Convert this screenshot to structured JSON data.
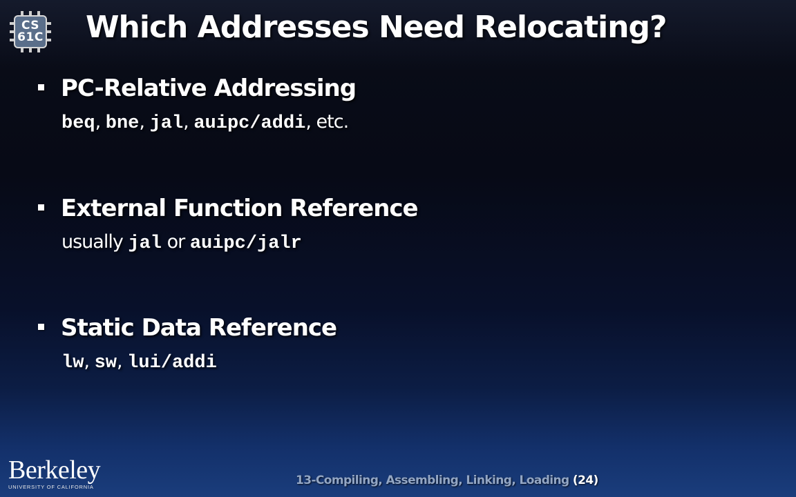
{
  "logo": {
    "line1": "CS",
    "line2": "61C"
  },
  "title": "Which Addresses Need Relocating?",
  "bullets": [
    {
      "heading": "PC-Relative Addressing",
      "detail": [
        {
          "text": "beq",
          "style": "code"
        },
        {
          "text": ", ",
          "style": "plain"
        },
        {
          "text": "bne",
          "style": "code"
        },
        {
          "text": ", ",
          "style": "plain"
        },
        {
          "text": "jal",
          "style": "code"
        },
        {
          "text": ", ",
          "style": "plain"
        },
        {
          "text": "auipc/addi",
          "style": "code"
        },
        {
          "text": ", etc.",
          "style": "plain"
        }
      ]
    },
    {
      "heading": "External Function Reference",
      "detail": [
        {
          "text": "usually ",
          "style": "plain"
        },
        {
          "text": "jal",
          "style": "code"
        },
        {
          "text": " or ",
          "style": "plain"
        },
        {
          "text": "auipc/jalr",
          "style": "code"
        }
      ]
    },
    {
      "heading": "Static Data Reference",
      "detail": [
        {
          "text": "lw",
          "style": "code"
        },
        {
          "text": ", ",
          "style": "plain"
        },
        {
          "text": "sw",
          "style": "code"
        },
        {
          "text": ", ",
          "style": "plain"
        },
        {
          "text": "lui/addi",
          "style": "code"
        }
      ]
    }
  ],
  "branding": {
    "name": "Berkeley",
    "subtitle": "UNIVERSITY OF CALIFORNIA"
  },
  "footer": {
    "lecture": "13-Compiling, Assembling, Linking, Loading",
    "page": "(24)"
  }
}
